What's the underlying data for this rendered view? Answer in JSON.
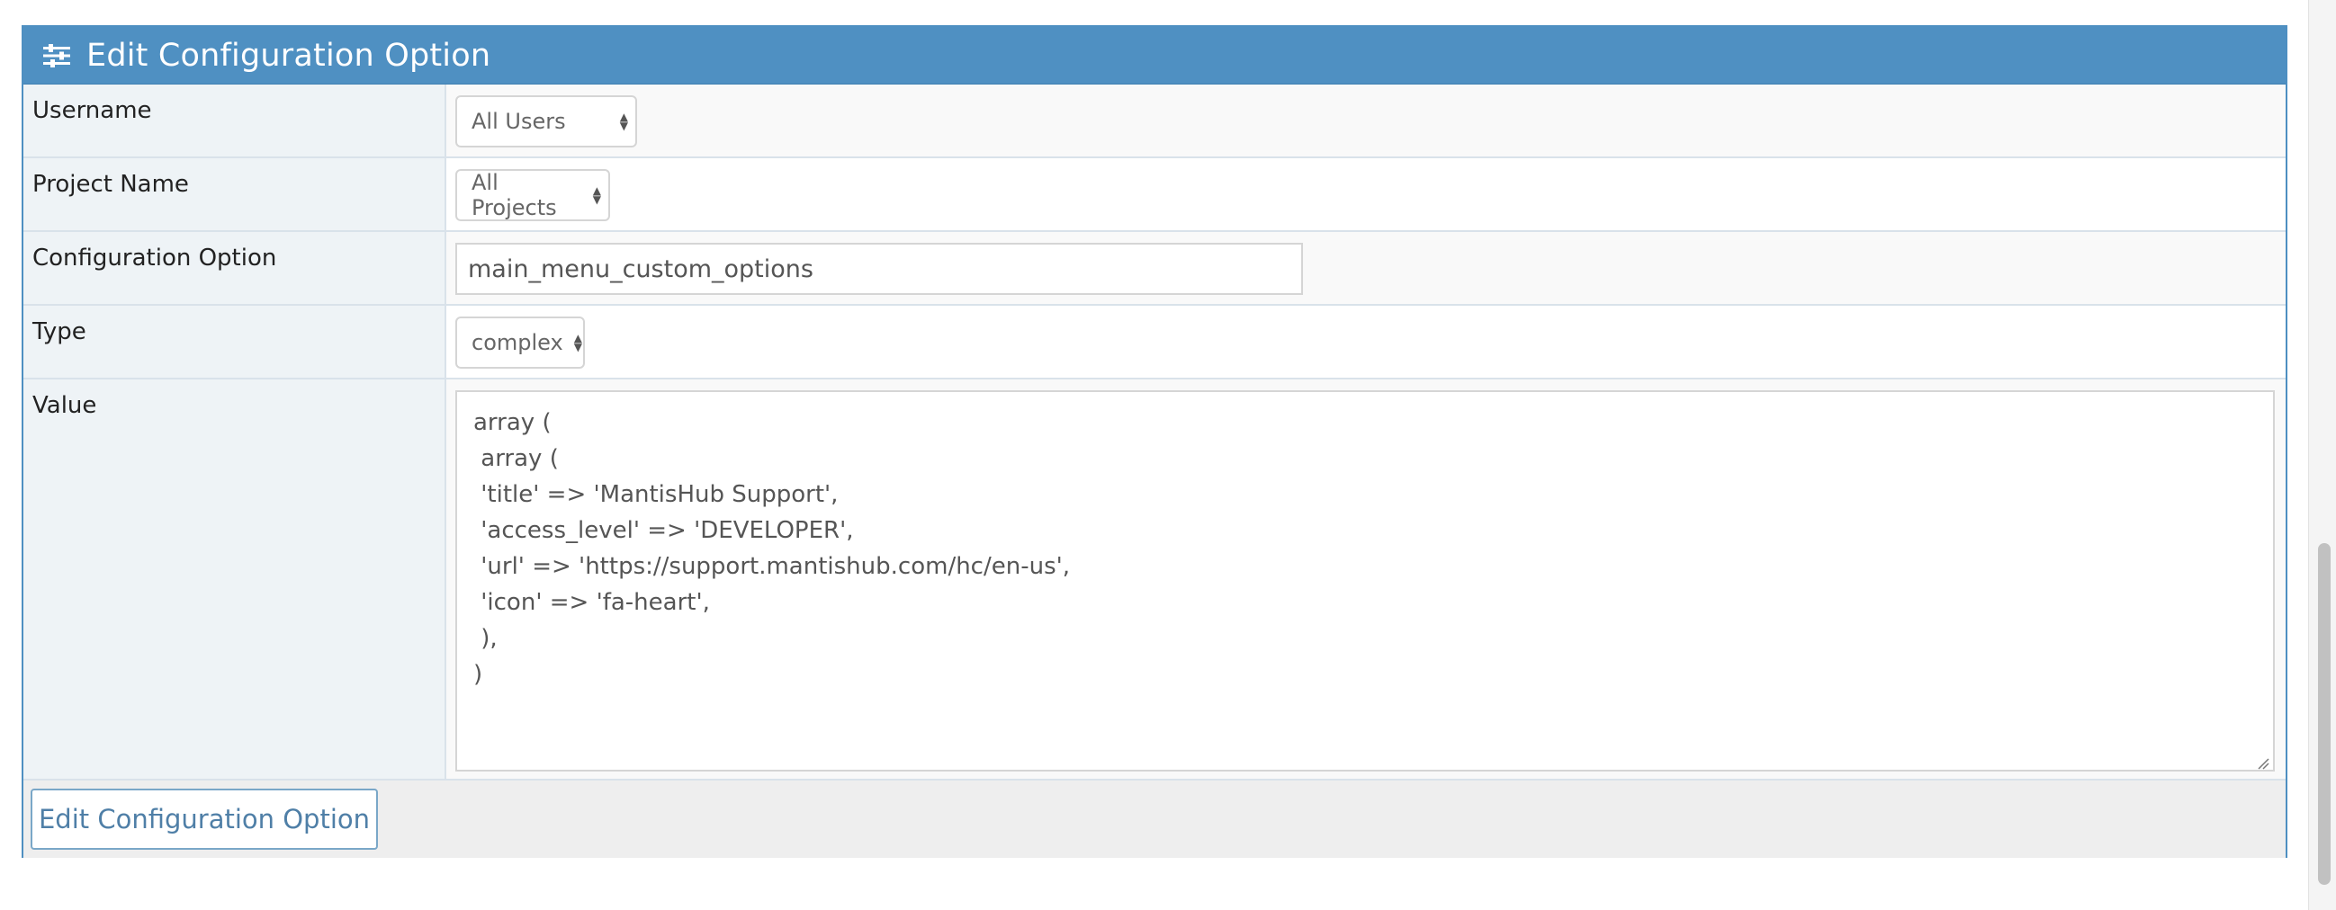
{
  "header": {
    "title": "Edit Configuration Option",
    "icon": "sliders-icon"
  },
  "form": {
    "username": {
      "label": "Username",
      "value": "All Users"
    },
    "project": {
      "label": "Project Name",
      "value": "All Projects"
    },
    "config_option": {
      "label": "Configuration Option",
      "value": "main_menu_custom_options"
    },
    "type": {
      "label": "Type",
      "value": "complex"
    },
    "value": {
      "label": "Value",
      "text": "array (\n array (\n 'title' => 'MantisHub Support',\n 'access_level' => 'DEVELOPER',\n 'url' => 'https://support.mantishub.com/hc/en-us',\n 'icon' => 'fa-heart',\n ),\n)"
    }
  },
  "footer": {
    "submit_label": "Edit Configuration Option"
  },
  "colors": {
    "header_bg": "#4f90c2",
    "border": "#4e8fc1",
    "label_bg": "#eef3f6",
    "button_text": "#4f7fa7"
  }
}
